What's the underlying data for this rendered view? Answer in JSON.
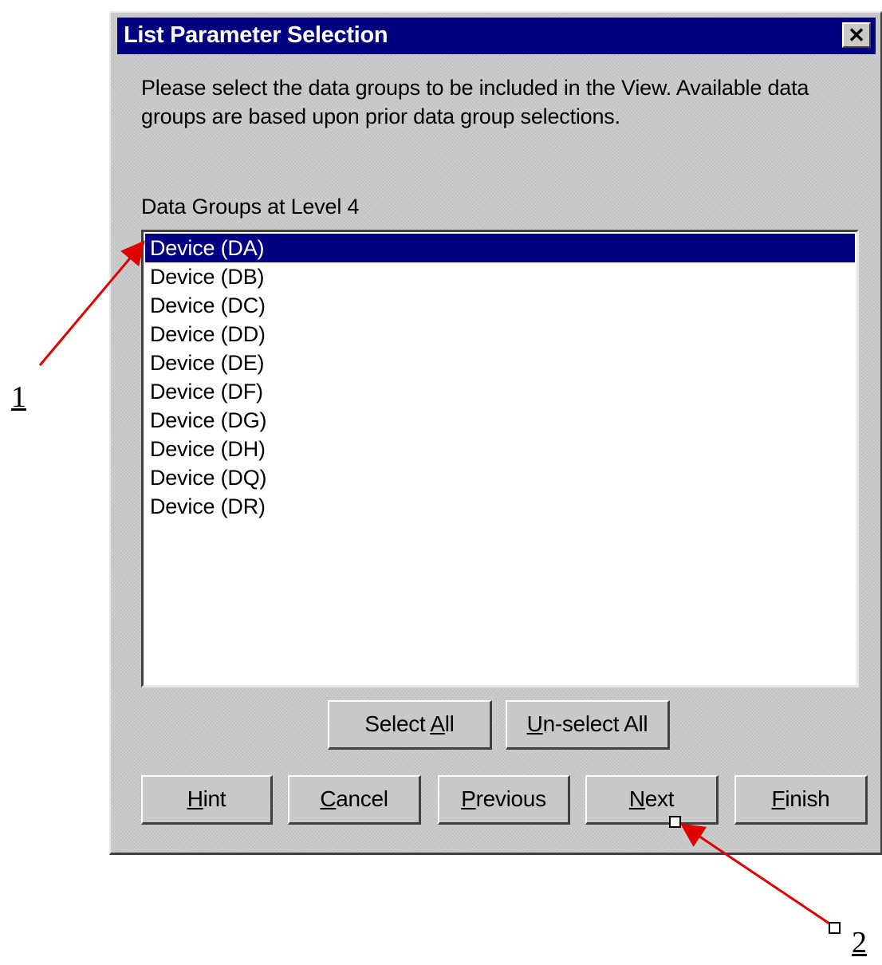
{
  "dialog": {
    "title": "List Parameter Selection",
    "close_label": "✕",
    "instructions": "Please select the data groups to be included in the View.  Available data groups are based upon prior data group selections.",
    "list_label": "Data Groups at Level  4",
    "items": [
      {
        "label": "Device (DA)",
        "selected": true
      },
      {
        "label": "Device (DB)",
        "selected": false
      },
      {
        "label": "Device (DC)",
        "selected": false
      },
      {
        "label": "Device (DD)",
        "selected": false
      },
      {
        "label": "Device (DE)",
        "selected": false
      },
      {
        "label": "Device (DF)",
        "selected": false
      },
      {
        "label": "Device (DG)",
        "selected": false
      },
      {
        "label": "Device (DH)",
        "selected": false
      },
      {
        "label": "Device (DQ)",
        "selected": false
      },
      {
        "label": "Device (DR)",
        "selected": false
      }
    ],
    "select_buttons": {
      "select_all": {
        "pre": "Select ",
        "u": "A",
        "post": "ll"
      },
      "unselect_all": {
        "pre": "",
        "u": "U",
        "post": "n-select All"
      }
    },
    "nav_buttons": {
      "hint": {
        "pre": "",
        "u": "H",
        "post": "int"
      },
      "cancel": {
        "pre": "",
        "u": "C",
        "post": "ancel"
      },
      "previous": {
        "pre": "",
        "u": "P",
        "post": "revious"
      },
      "next": {
        "pre": "",
        "u": "N",
        "post": "ext"
      },
      "finish": {
        "pre": "",
        "u": "F",
        "post": "inish"
      }
    }
  },
  "annotations": {
    "one": "1",
    "two": "2",
    "arrow_color": "#e00000"
  }
}
